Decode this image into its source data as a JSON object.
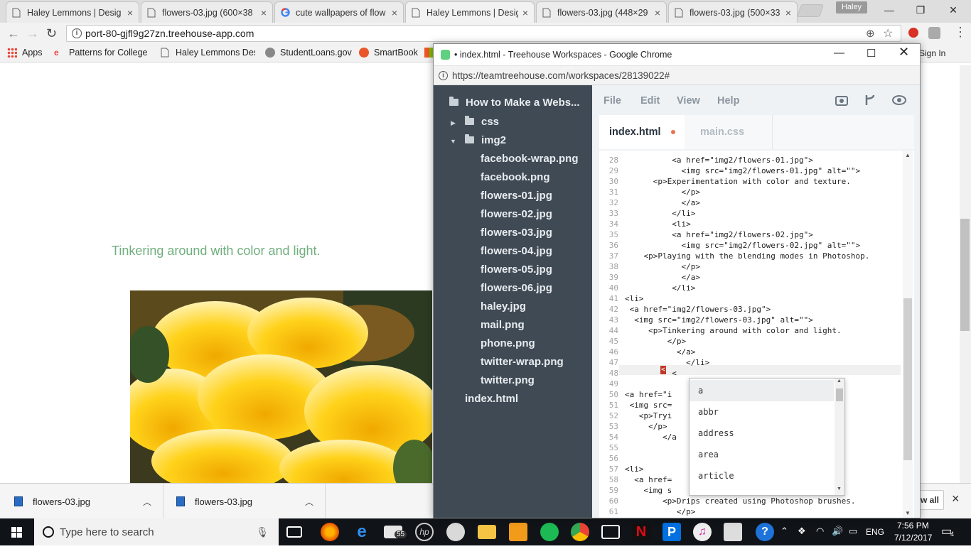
{
  "browser": {
    "tabs": [
      {
        "title": "Haley Lemmons | Desig",
        "icon": "doc-icon"
      },
      {
        "title": "flowers-03.jpg (600×38",
        "icon": "doc-icon"
      },
      {
        "title": "cute wallpapers of flow",
        "icon": "google-icon"
      },
      {
        "title": "Haley Lemmons | Desig",
        "icon": "doc-icon"
      },
      {
        "title": "flowers-03.jpg (448×29",
        "icon": "doc-icon"
      },
      {
        "title": "flowers-03.jpg (500×33",
        "icon": "doc-icon"
      }
    ],
    "profile_name": "Haley",
    "url": "port-80-gjfl9g27zn.treehouse-app.com",
    "bookmarks": [
      {
        "label": "Apps"
      },
      {
        "label": "Patterns for College W"
      },
      {
        "label": "Haley Lemmons Desi"
      },
      {
        "label": "StudentLoans.gov"
      },
      {
        "label": "SmartBook"
      }
    ],
    "signin_label": "Sign In"
  },
  "page": {
    "caption": "Tinkering around with color and light."
  },
  "downloads": {
    "items": [
      {
        "name": "flowers-03.jpg"
      },
      {
        "name": "flowers-03.jpg"
      }
    ],
    "show_all_label": "w all"
  },
  "taskbar": {
    "search_placeholder": "Type here to search",
    "mail_badge": "55",
    "language": "ENG",
    "time": "7:56 PM",
    "date": "7/12/2017",
    "notification_count": "4"
  },
  "workspace_window": {
    "title": "• index.html - Treehouse Workspaces - Google Chrome",
    "url": "https://teamtreehouse.com/workspaces/28139022#",
    "project_name": "How to Make a Webs...",
    "tree": [
      {
        "label": "css",
        "type": "folder",
        "expanded": false
      },
      {
        "label": "img2",
        "type": "folder",
        "expanded": true
      },
      {
        "label": "facebook-wrap.png",
        "type": "file"
      },
      {
        "label": "facebook.png",
        "type": "file"
      },
      {
        "label": "flowers-01.jpg",
        "type": "file"
      },
      {
        "label": "flowers-02.jpg",
        "type": "file"
      },
      {
        "label": "flowers-03.jpg",
        "type": "file"
      },
      {
        "label": "flowers-04.jpg",
        "type": "file"
      },
      {
        "label": "flowers-05.jpg",
        "type": "file"
      },
      {
        "label": "flowers-06.jpg",
        "type": "file"
      },
      {
        "label": "haley.jpg",
        "type": "file"
      },
      {
        "label": "mail.png",
        "type": "file"
      },
      {
        "label": "phone.png",
        "type": "file"
      },
      {
        "label": "twitter-wrap.png",
        "type": "file"
      },
      {
        "label": "twitter.png",
        "type": "file"
      },
      {
        "label": "index.html",
        "type": "root-file"
      }
    ],
    "menu": [
      "File",
      "Edit",
      "View",
      "Help"
    ],
    "editor_tabs": [
      {
        "label": "index.html",
        "active": true,
        "modified": true
      },
      {
        "label": "main.css",
        "active": false,
        "modified": false
      }
    ],
    "code_lines": [
      {
        "n": "28",
        "text": "          <a href=\"img2/flowers-01.jpg\">"
      },
      {
        "n": "29",
        "text": "            <img src=\"img2/flowers-01.jpg\" alt=\"\">"
      },
      {
        "n": "30",
        "text": "      <p>Experimentation with color and texture."
      },
      {
        "n": "31",
        "text": "            </p>"
      },
      {
        "n": "32",
        "text": "            </a>"
      },
      {
        "n": "33",
        "text": "          </li>"
      },
      {
        "n": "34",
        "text": "          <li>"
      },
      {
        "n": "35",
        "text": "          <a href=\"img2/flowers-02.jpg\">"
      },
      {
        "n": "36",
        "text": "            <img src=\"img2/flowers-02.jpg\" alt=\"\">"
      },
      {
        "n": "37",
        "text": "    <p>Playing with the blending modes in Photoshop."
      },
      {
        "n": "38",
        "text": "            </p>"
      },
      {
        "n": "39",
        "text": "            </a>"
      },
      {
        "n": "40",
        "text": "          </li>"
      },
      {
        "n": "41",
        "text": "<li>"
      },
      {
        "n": "42",
        "text": " <a href=\"img2/flowers-03.jpg\">"
      },
      {
        "n": "43",
        "text": "  <img src=\"img2/flowers-03.jpg\" alt=\"\">"
      },
      {
        "n": "44",
        "text": "     <p>Tinkering around with color and light."
      },
      {
        "n": "45",
        "text": "         </p>"
      },
      {
        "n": "46",
        "text": "           </a>"
      },
      {
        "n": "47",
        "text": "             </li>"
      },
      {
        "n": "48",
        "text": "          <"
      },
      {
        "n": "49",
        "text": ""
      },
      {
        "n": "50",
        "text": "<a href=\"i"
      },
      {
        "n": "51",
        "text": " <img src="
      },
      {
        "n": "52",
        "text": "   <p>Tryi                            f petals."
      },
      {
        "n": "53",
        "text": "     </p>"
      },
      {
        "n": "54",
        "text": "        </a"
      },
      {
        "n": "55",
        "text": ""
      },
      {
        "n": "56",
        "text": ""
      },
      {
        "n": "57",
        "text": "<li>"
      },
      {
        "n": "58",
        "text": "  <a href="
      },
      {
        "n": "59",
        "text": "    <img s                           >"
      },
      {
        "n": "60",
        "text": "        <p>Drips created using Photoshop brushes."
      },
      {
        "n": "61",
        "text": "           </p>"
      }
    ],
    "autocomplete": [
      "a",
      "abbr",
      "address",
      "area",
      "article"
    ]
  },
  "colors": {
    "caption_green": "#6fae7d",
    "sidebar_bg": "#3f4a55",
    "modified_dot": "#e8744f",
    "taskbar_bg": "#101418"
  }
}
